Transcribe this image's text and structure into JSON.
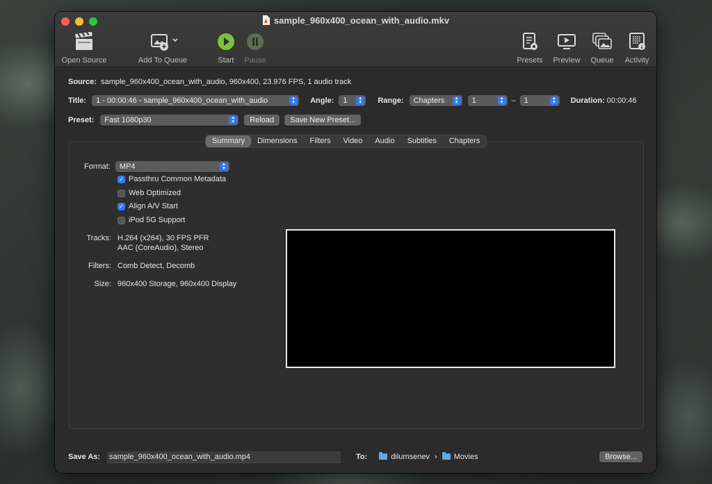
{
  "window": {
    "title": "sample_960x400_ocean_with_audio.mkv"
  },
  "toolbar": {
    "open_source": "Open Source",
    "add_to_queue": "Add To Queue",
    "start": "Start",
    "pause": "Pause",
    "presets": "Presets",
    "preview": "Preview",
    "queue": "Queue",
    "activity": "Activity"
  },
  "source": {
    "label": "Source:",
    "value": "sample_960x400_ocean_with_audio, 960x400, 23.976 FPS, 1 audio track"
  },
  "title_row": {
    "title_label": "Title:",
    "title_value": "1 - 00:00:46 - sample_960x400_ocean_with_audio",
    "angle_label": "Angle:",
    "angle_value": "1",
    "range_label": "Range:",
    "range_type": "Chapters",
    "range_start": "1",
    "range_dash": "–",
    "range_end": "1",
    "duration_label": "Duration:",
    "duration_value": "00:00:46"
  },
  "preset_row": {
    "label": "Preset:",
    "value": "Fast 1080p30",
    "reload": "Reload",
    "save_new": "Save New Preset..."
  },
  "tabs": [
    "Summary",
    "Dimensions",
    "Filters",
    "Video",
    "Audio",
    "Subtitles",
    "Chapters"
  ],
  "summary": {
    "format_label": "Format:",
    "format_value": "MP4",
    "checkboxes": [
      {
        "label": "Passthru Common Metadata",
        "checked": true
      },
      {
        "label": "Web Optimized",
        "checked": false
      },
      {
        "label": "Align A/V Start",
        "checked": true
      },
      {
        "label": "iPod 5G Support",
        "checked": false
      }
    ],
    "tracks_label": "Tracks:",
    "tracks_line1": "H.264 (x264), 30 FPS PFR",
    "tracks_line2": "AAC (CoreAudio), Stereo",
    "filters_label": "Filters:",
    "filters_value": "Comb Detect, Decomb",
    "size_label": "Size:",
    "size_value": "960x400 Storage, 960x400 Display"
  },
  "save": {
    "label": "Save As:",
    "filename": "sample_960x400_ocean_with_audio.mp4",
    "to_label": "To:",
    "folder1": "dilumsenev",
    "separator": "›",
    "folder2": "Movies",
    "browse": "Browse..."
  },
  "colors": {
    "accent": "#3478f6",
    "start_green": "#7ec13c",
    "close": "#ff5f57",
    "minimize": "#febc2e",
    "zoom": "#28c840"
  }
}
